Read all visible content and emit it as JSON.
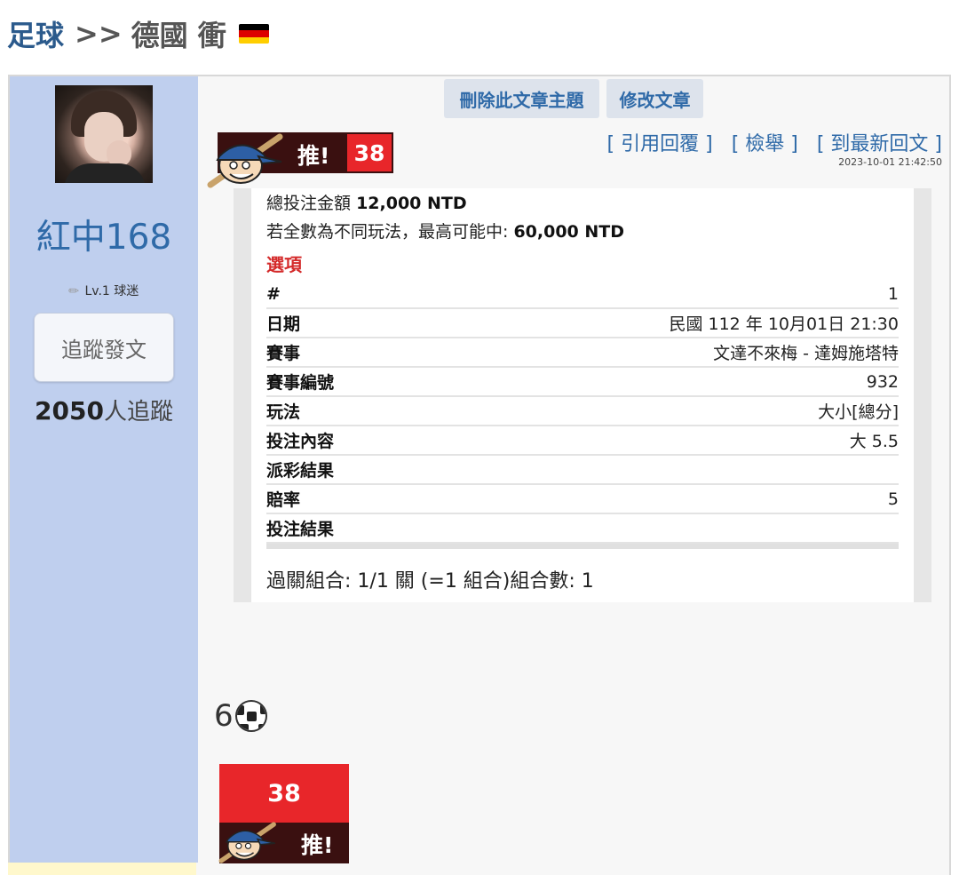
{
  "breadcrumb": {
    "section": "足球",
    "separator": ">>",
    "title": "德國 衝"
  },
  "flag_colors": [
    "#000000",
    "#dd0000",
    "#ffce00"
  ],
  "author": {
    "name": "紅中168",
    "level": "Lv.1 球迷",
    "follow_button": "追蹤發文",
    "follower_count": "2050",
    "follower_suffix": "人追蹤"
  },
  "toolbar": {
    "delete_topic": "刪除此文章主題",
    "edit_post": "修改文章"
  },
  "push": {
    "label": "推!",
    "count": "38"
  },
  "post_actions": {
    "quote": "[ 引用回覆 ]",
    "report": "[ 檢舉 ]",
    "latest": "[ 到最新回文 ]"
  },
  "timestamp": "2023-10-01 21:42:50",
  "bet": {
    "total_label": "總投注金額",
    "total_value": "12,000 NTD",
    "max_label": "若全數為不同玩法，最高可能中:",
    "max_value": "60,000 NTD",
    "options_title": "選項",
    "rows": [
      {
        "key": "#",
        "value": "1"
      },
      {
        "key": "日期",
        "value": "民國 112 年 10月01日 21:30"
      },
      {
        "key": "賽事",
        "value": "文達不來梅 - 達姆施塔特"
      },
      {
        "key": "賽事編號",
        "value": "932"
      },
      {
        "key": "玩法",
        "value": "大小[總分]"
      },
      {
        "key": "投注內容",
        "value": "大 5.5"
      },
      {
        "key": "派彩結果",
        "value": ""
      },
      {
        "key": "賠率",
        "value": "5"
      },
      {
        "key": "投注結果",
        "value": ""
      }
    ],
    "combo": "過關組合: 1/1 關 (=1 組合)組合數: 1"
  },
  "post_body": "6",
  "colors": {
    "accent_blue": "#2f6aa8",
    "sidebar_bg": "#bfcfee",
    "push_red": "#e8262a",
    "push_dark": "#3a1010",
    "options_red": "#d42a2a"
  }
}
